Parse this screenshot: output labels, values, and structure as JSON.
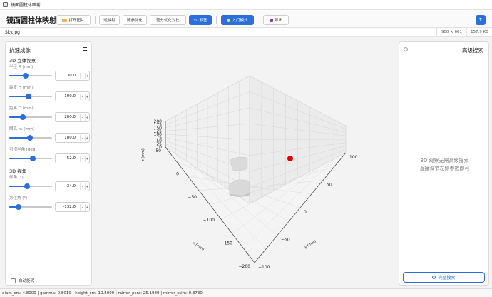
{
  "window": {
    "title": "镜面圆柱体映射"
  },
  "toolbar": {
    "app_name": "镜面圆柱体映射",
    "open_image": "打开图片",
    "inverse_map": "逆映射",
    "random_opt": "随参优化",
    "diff_opt": "差分优化对比",
    "view_3d": "3D 视图",
    "tutorial": "入门模式",
    "export": "导出",
    "help": "?"
  },
  "file": {
    "name": "Sky.jpg",
    "dims": "900 × 601",
    "size": "157.9 KB"
  },
  "left_panel": {
    "title": "抗速成像",
    "section_3d": "3D 立体视察",
    "section_view": "3D 视角",
    "params": [
      {
        "label": "半径 R (mm)",
        "value": "30.0",
        "fraction": 0.38
      },
      {
        "label": "高度 H (mm)",
        "value": "100.0",
        "fraction": 0.45
      },
      {
        "label": "距离 D (mm)",
        "value": "200.0",
        "fraction": 0.32
      },
      {
        "label": "眼高 h₀ (mm)",
        "value": "180.0",
        "fraction": 0.48
      },
      {
        "label": "可视半角 (deg)",
        "value": "52.0",
        "fraction": 0.55
      }
    ],
    "view_params": [
      {
        "label": "仰角 (°)",
        "value": "34.0",
        "fraction": 0.42
      },
      {
        "label": "方位角 (°)",
        "value": "-132.0",
        "fraction": 0.22
      }
    ],
    "spin_minus": "-",
    "spin_plus": "+",
    "auto_rotate": "自动旋转"
  },
  "right_panel": {
    "title": "高级搜索",
    "hint_line1": "3D 观察无需高级搜索",
    "hint_line2": "直接调节左侧参数即可",
    "search_button": "完整搜索"
  },
  "plot": {
    "z_ticks": [
      "0",
      "25",
      "50",
      "75",
      "100",
      "125",
      "150",
      "175",
      "200"
    ],
    "x_ticks": [
      "50",
      "0",
      "−50",
      "−100",
      "−150",
      "−200"
    ],
    "y_ticks": [
      "−100",
      "−50",
      "0",
      "50",
      "100"
    ],
    "x_label": "x (mm)",
    "y_label": "y (mm)",
    "z_label": "z (mm)",
    "eye_color": "#e00000"
  },
  "status": {
    "text": "diam_cm: 4.8000 | gamma: 0.8019 | height_cm: 10.5000 | mirror_psnr: 25.1989 | mirror_ssim: 0.8730"
  },
  "colors": {
    "accent": "#2a6fdb"
  }
}
